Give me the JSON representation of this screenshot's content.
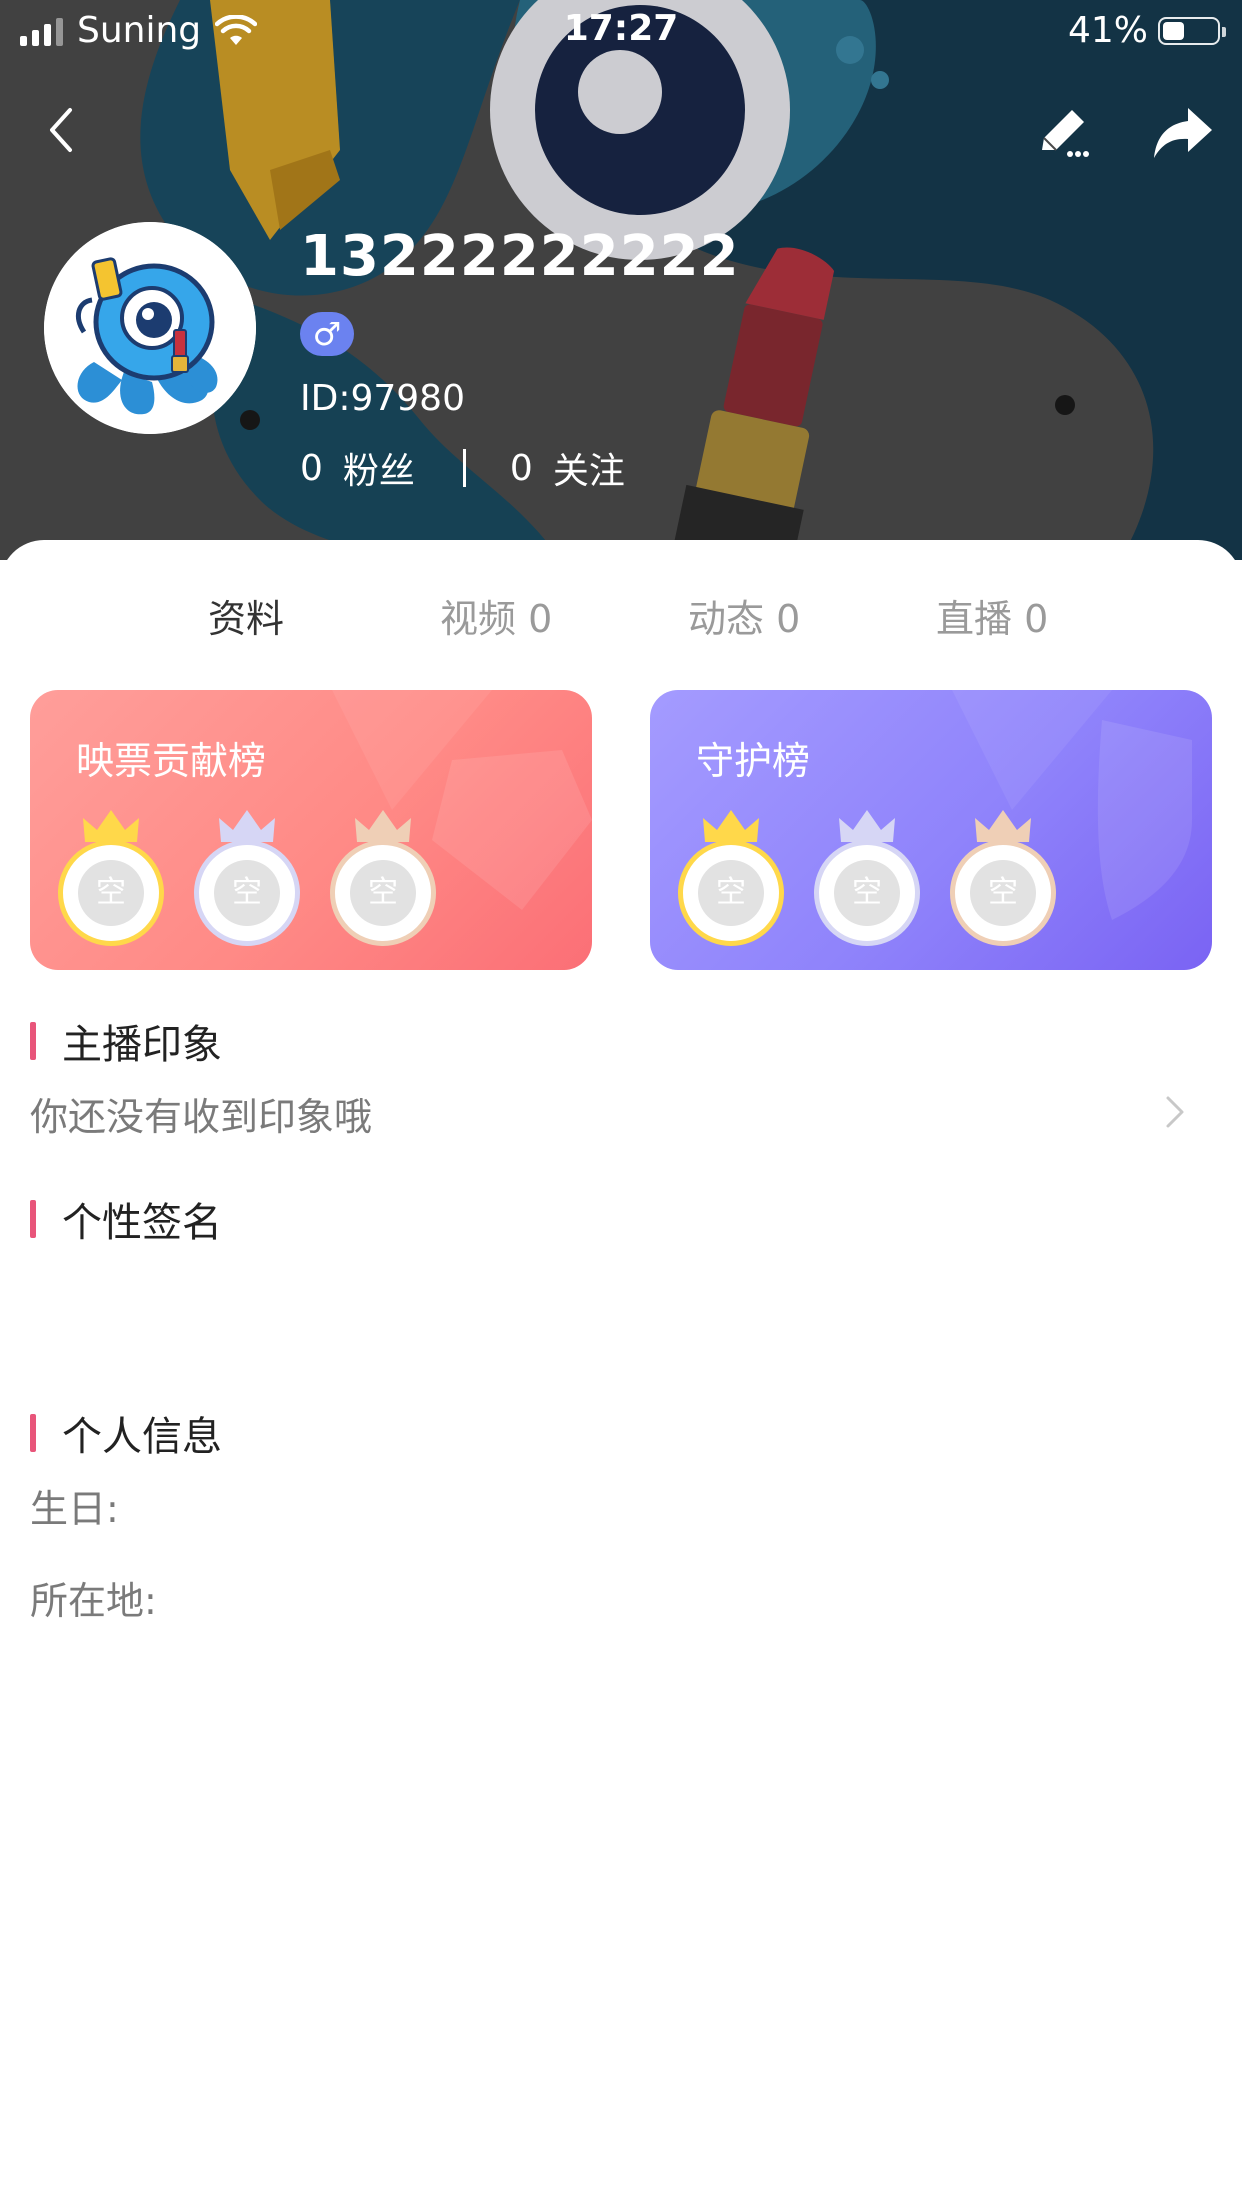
{
  "status_bar": {
    "carrier": "Suning",
    "time": "17:27",
    "battery_percent": "41%",
    "battery_level": 0.41
  },
  "nav": {
    "back_icon": "chevron-left-icon",
    "edit_icon": "edit-pen-icon",
    "share_icon": "share-arrow-icon"
  },
  "profile": {
    "username": "13222222222",
    "gender_symbol": "♂",
    "user_id": "ID:97980",
    "fans_count": "0",
    "fans_label": "粉丝",
    "following_count": "0",
    "following_label": "关注"
  },
  "tabs": [
    {
      "label": "资料",
      "active": true
    },
    {
      "label": "视频 0",
      "active": false
    },
    {
      "label": "动态 0",
      "active": false
    },
    {
      "label": "直播 0",
      "active": false
    }
  ],
  "cards": {
    "contribution": {
      "title": "映票贡献榜",
      "slots": [
        "空",
        "空",
        "空"
      ]
    },
    "guardian": {
      "title": "守护榜",
      "slots": [
        "空",
        "空",
        "空"
      ]
    }
  },
  "sections": {
    "impression": {
      "title": "主播印象",
      "text": "你还没有收到印象哦"
    },
    "signature": {
      "title": "个性签名",
      "text": ""
    },
    "personal_info": {
      "title": "个人信息",
      "birthday_label": "生日:",
      "location_label": "所在地:"
    }
  },
  "colors": {
    "accent": "#e8557a",
    "gender_badge": "#6b82f0",
    "card_pink": "#ff8a86",
    "card_purple": "#8f83fb",
    "crown_gold": "#ffd84a",
    "crown_silver": "#d6d6f5",
    "crown_bronze": "#efcfb6"
  }
}
